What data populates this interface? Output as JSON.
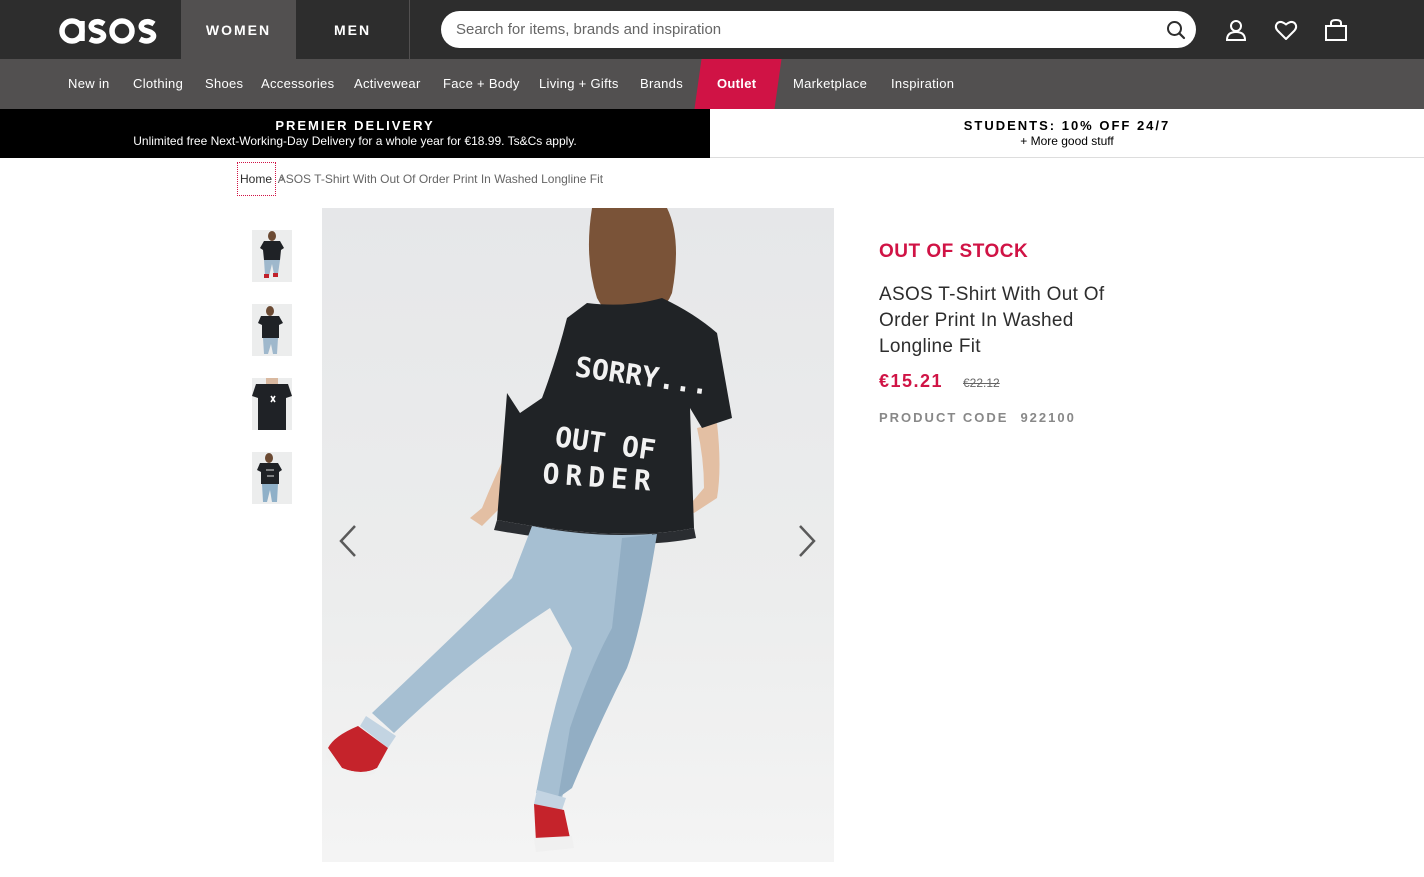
{
  "header": {
    "logo_text": "asos",
    "tabs": [
      {
        "label": "WOMEN",
        "active": true
      },
      {
        "label": "MEN",
        "active": false
      }
    ],
    "search": {
      "placeholder": "Search for items, brands and inspiration"
    },
    "icons": [
      "account-icon",
      "heart-icon",
      "bag-icon"
    ]
  },
  "nav": {
    "items": [
      "New in",
      "Clothing",
      "Shoes",
      "Accessories",
      "Activewear",
      "Face + Body",
      "Living + Gifts",
      "Brands",
      "Outlet",
      "Marketplace",
      "Inspiration"
    ],
    "outlet_color": "#d01345"
  },
  "banners": {
    "left": {
      "title": "PREMIER DELIVERY",
      "subtitle": "Unlimited free Next-Working-Day Delivery for a whole year for €18.99. Ts&Cs apply."
    },
    "right": {
      "title": "STUDENTS: 10% OFF 24/7",
      "subtitle": "+ More good stuff"
    }
  },
  "breadcrumb": {
    "home": "Home",
    "separator": "›",
    "current": "ASOS T-Shirt With Out Of Order Print In Washed Longline Fit"
  },
  "gallery": {
    "thumbnail_count": 4,
    "tshirt_print": {
      "line1": "SORRY...",
      "line2": "OUT OF",
      "line3": "ORDER"
    }
  },
  "product": {
    "stock_status": "OUT OF STOCK",
    "title": "ASOS T-Shirt With Out Of Order Print In Washed Longline Fit",
    "price": "€15.21",
    "price_was": "€22.12",
    "code_label": "PRODUCT CODE",
    "code": "922100"
  },
  "colors": {
    "brand_dark": "#2d2d2d",
    "nav_grey": "#525050",
    "accent": "#d01345"
  }
}
